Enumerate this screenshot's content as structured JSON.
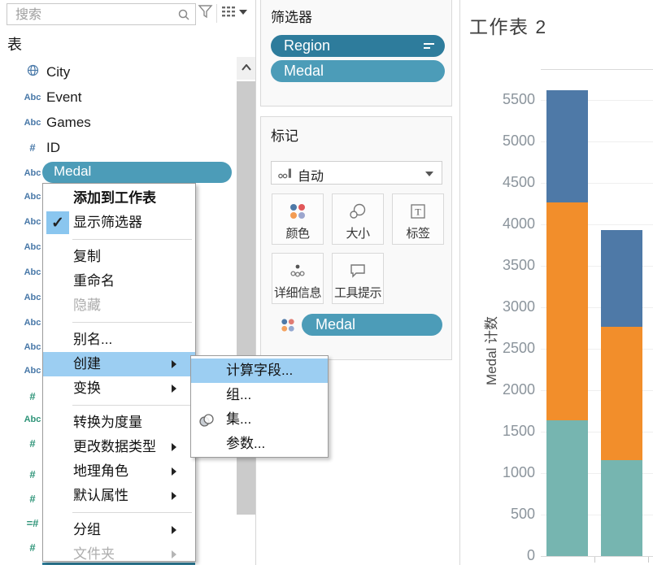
{
  "data_pane": {
    "search_placeholder": "搜索",
    "section_title": "表",
    "fields": [
      {
        "icon": "globe",
        "label": "City"
      },
      {
        "icon": "Abc",
        "label": "Event"
      },
      {
        "icon": "Abc",
        "label": "Games"
      },
      {
        "icon": "#",
        "label": "ID"
      },
      {
        "icon": "Abc",
        "label": "Medal"
      }
    ],
    "rail_icons": [
      {
        "glyph": "Abc",
        "type": "dimension"
      },
      {
        "glyph": "Abc",
        "type": "dimension"
      },
      {
        "glyph": "Abc",
        "type": "dimension"
      },
      {
        "glyph": "Abc",
        "type": "dimension"
      },
      {
        "glyph": "Abc",
        "type": "dimension"
      },
      {
        "glyph": "Abc",
        "type": "dimension"
      },
      {
        "glyph": "Abc",
        "type": "dimension"
      },
      {
        "glyph": "Abc",
        "type": "dimension"
      },
      {
        "glyph": "#",
        "type": "measure"
      },
      {
        "glyph": "Abc",
        "type": "measure"
      },
      {
        "glyph": "#",
        "type": "measure"
      },
      {
        "glyph": "#",
        "type": "measure"
      },
      {
        "glyph": "#",
        "type": "measure"
      },
      {
        "glyph": "=#",
        "type": "measure"
      },
      {
        "glyph": "#",
        "type": "measure"
      }
    ]
  },
  "context_menu": {
    "items": [
      {
        "label": "添加到工作表"
      },
      {
        "label": "显示筛选器",
        "checked": true
      },
      {
        "label": "复制"
      },
      {
        "label": "重命名"
      },
      {
        "label": "隐藏"
      },
      {
        "label": "别名..."
      },
      {
        "label": "创建"
      },
      {
        "label": "变换"
      },
      {
        "label": "转换为度量"
      },
      {
        "label": "更改数据类型"
      },
      {
        "label": "地理角色"
      },
      {
        "label": "默认属性"
      },
      {
        "label": "分组"
      },
      {
        "label": "文件夹"
      }
    ],
    "check_glyph": "✓"
  },
  "create_submenu": {
    "items": [
      {
        "label": "计算字段..."
      },
      {
        "label": "组..."
      },
      {
        "label": "集..."
      },
      {
        "label": "参数..."
      }
    ]
  },
  "filters_card": {
    "title": "筛选器",
    "pills": [
      {
        "label": "Region"
      },
      {
        "label": "Medal"
      }
    ]
  },
  "marks_card": {
    "title": "标记",
    "mark_type_label": "自动",
    "buttons": [
      {
        "label": "颜色"
      },
      {
        "label": "大小"
      },
      {
        "label": "标签"
      },
      {
        "label": "详细信息"
      },
      {
        "label": "工具提示"
      }
    ],
    "pill": {
      "label": "Medal"
    }
  },
  "worksheet": {
    "title": "工作表 2"
  },
  "chart_data": {
    "type": "bar",
    "stacked": true,
    "title": "工作表 2",
    "xlabel": "",
    "ylabel": "Medal 计数",
    "ylim": [
      0,
      5750
    ],
    "yticks": [
      0,
      500,
      1000,
      1500,
      2000,
      2500,
      3000,
      3500,
      4000,
      4500,
      5000,
      5500
    ],
    "grid": true,
    "legend": "none",
    "categories": [
      "",
      ""
    ],
    "series": [
      {
        "name": "teal",
        "color": "#76B5B0",
        "values": [
          1640,
          1160
        ]
      },
      {
        "name": "orange",
        "color": "#F28E2B",
        "values": [
          2620,
          1600
        ]
      },
      {
        "name": "blue",
        "color": "#4E79A7",
        "values": [
          1360,
          1170
        ]
      }
    ],
    "totals": [
      5620,
      3930
    ]
  },
  "colors": {
    "pill_dark": "#2E7C9C",
    "pill_light": "#4C9CB8",
    "menu_highlight": "#9CCEF2",
    "dimension_icon": "#4878A8",
    "measure_icon": "#2E9478"
  }
}
